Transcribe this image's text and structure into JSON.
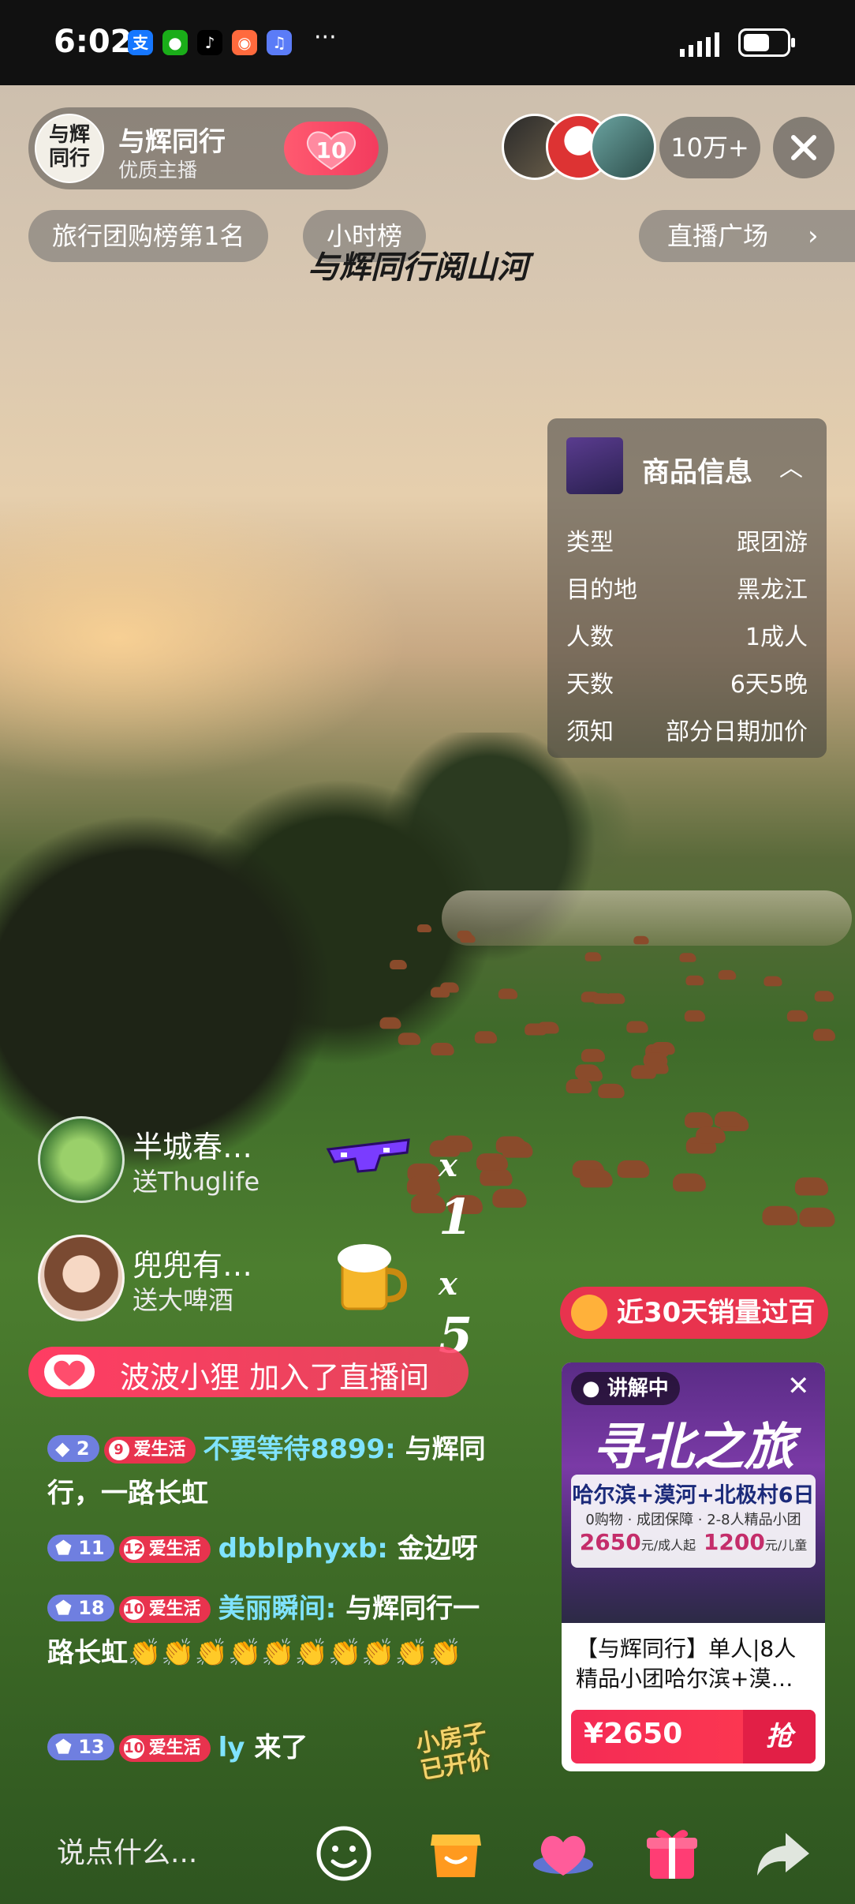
{
  "status_bar": {
    "time": "6:02",
    "app_icons": [
      {
        "name": "alipay-icon",
        "glyph": "支",
        "color": "#1677ff"
      },
      {
        "name": "wechat-icon",
        "glyph": "●",
        "color": "#1aad19"
      },
      {
        "name": "tiktok-icon",
        "glyph": "♪",
        "color": "#000000"
      },
      {
        "name": "app-icon",
        "glyph": "◉",
        "color": "#ff6a3d"
      },
      {
        "name": "music-icon",
        "glyph": "♫",
        "color": "#5b7cf7"
      }
    ],
    "more": "···",
    "battery_level": 0.6
  },
  "host": {
    "avatar_text": "与辉\n同行",
    "name": "与辉同行",
    "subtitle": "优质主播",
    "like_count": "10"
  },
  "viewers": {
    "count": "10万+"
  },
  "chips": {
    "rank": "旅行团购榜第1名",
    "hour": "小时榜",
    "plaza": "直播广场"
  },
  "calligraphy": "与辉同行阅山河",
  "product_info": {
    "title": "商品信息",
    "rows": [
      {
        "key": "类型",
        "value": "跟团游"
      },
      {
        "key": "目的地",
        "value": "黑龙江"
      },
      {
        "key": "人数",
        "value": "1成人"
      },
      {
        "key": "天数",
        "value": "6天5晚"
      },
      {
        "key": "须知",
        "value": "部分日期加价"
      }
    ]
  },
  "gifts": [
    {
      "user": "半城春…",
      "desc": "送Thuglife",
      "count": "1",
      "x": "x"
    },
    {
      "user": "兜兜有…",
      "desc": "送大啤酒",
      "count": "5",
      "x": "x"
    }
  ],
  "join_notice": "波波小狸 加入了直播间",
  "chat": [
    {
      "level": "2",
      "fan_level": "9",
      "fan_label": "爱生活",
      "user": "不要等待8899:",
      "message": "与辉同行，一路长虹"
    },
    {
      "level": "11",
      "fan_level": "12",
      "fan_label": "爱生活",
      "user": "dbblphyxb:",
      "message": "金边呀"
    },
    {
      "level": "18",
      "fan_level": "10",
      "fan_label": "爱生活",
      "user": "美丽瞬间:",
      "message": "与辉同行一路长虹👏👏👏👏👏👏👏👏👏👏"
    },
    {
      "level": "13",
      "fan_level": "10",
      "fan_label": "爱生活",
      "user": "ly",
      "message": "来了"
    }
  ],
  "sales_tag": "近30天销量过百",
  "product_card": {
    "live_label": "● 讲解中",
    "banner_title": "寻北之旅",
    "route": "哈尔滨+漠河+北极村6日",
    "features": "0购物 · 成团保障 · 2-8人精品小团",
    "adult_price": "2650",
    "adult_unit": "元/成人起",
    "child_price": "1200",
    "child_unit": "元/儿童",
    "description": "【与辉同行】单人|8人精品小团哈尔滨+漠…",
    "price": "¥2650",
    "buy_label": "抢"
  },
  "watermark": "小房子\n已开价",
  "bottom_bar": {
    "input_placeholder": "说点什么..."
  },
  "colors": {
    "accent_red": "#e8334e",
    "chat_username": "#7fe3ff",
    "level_badge": "#6f7fe0"
  }
}
